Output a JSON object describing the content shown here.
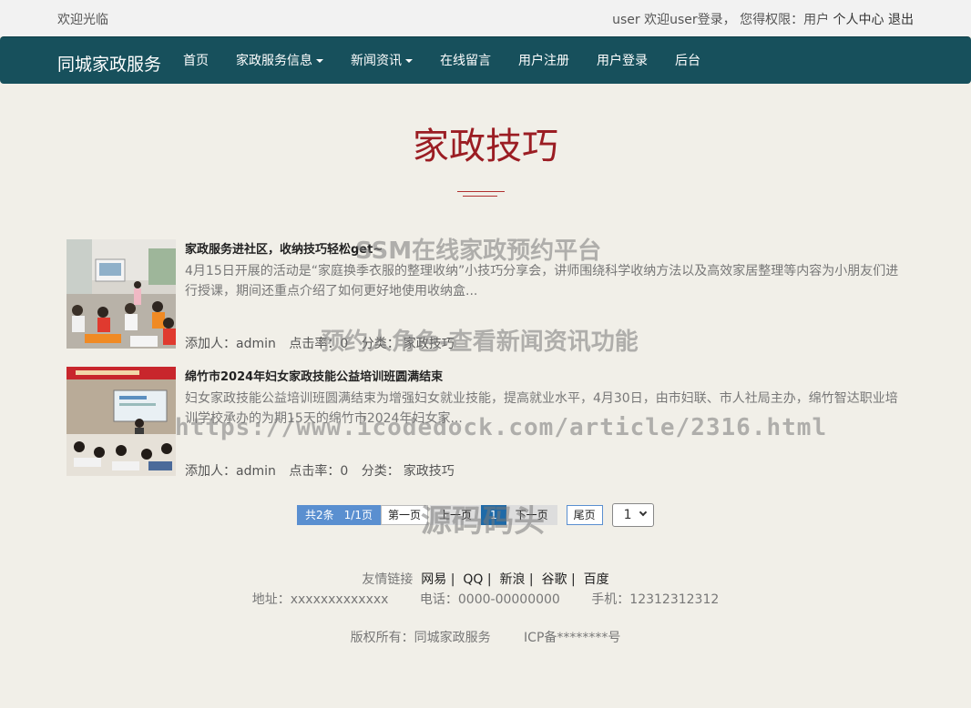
{
  "topbar": {
    "welcome": "欢迎光临",
    "user_text": "user 欢迎user登录， 您得权限：用户",
    "profile_link": "个人中心",
    "logout_link": "退出"
  },
  "nav": {
    "brand": "同城家政服务",
    "items": [
      {
        "label": "首页",
        "dropdown": false
      },
      {
        "label": "家政服务信息",
        "dropdown": true
      },
      {
        "label": "新闻资讯",
        "dropdown": true
      },
      {
        "label": "在线留言",
        "dropdown": false
      },
      {
        "label": "用户注册",
        "dropdown": false
      },
      {
        "label": "用户登录",
        "dropdown": false
      },
      {
        "label": "后台",
        "dropdown": false
      }
    ]
  },
  "page_title": "家政技巧",
  "articles": [
    {
      "title": "家政服务进社区，收纳技巧轻松get~",
      "desc": "4月15日开展的活动是“家庭换季衣服的整理收纳”小技巧分享会，讲师围绕科学收纳方法以及高效家居整理等内容为小朋友们进行授课，期间还重点介绍了如何更好地使用收纳盒...",
      "author_label": "添加人：admin",
      "clicks_label": "点击率：0",
      "category_label": "分类：",
      "category": "家政技巧"
    },
    {
      "title": "绵竹市2024年妇女家政技能公益培训班圆满结束",
      "desc": "妇女家政技能公益培训班圆满结束为增强妇女就业技能，提高就业水平，4月30日，由市妇联、市人社局主办，绵竹智达职业培训学校承办的为期15天的绵竹市2024年妇女家...",
      "author_label": "添加人：admin",
      "clicks_label": "点击率：0",
      "category_label": "分类：",
      "category": "家政技巧"
    }
  ],
  "pager": {
    "total": "共2条",
    "pages": "1/1页",
    "first": "第一页",
    "prev": "上一页",
    "current": "1",
    "next": "下一页",
    "last": "尾页",
    "select_value": "1"
  },
  "footer": {
    "links_label": "友情链接",
    "links": [
      "网易 |",
      "QQ |",
      "新浪 |",
      "谷歌 |",
      "百度"
    ],
    "address": "地址：xxxxxxxxxxxxx",
    "phone": "电话：0000-00000000",
    "mobile": "手机：12312312312",
    "copyright": "版权所有：同城家政服务",
    "icp": "ICP备********号"
  },
  "watermarks": {
    "w1": "SSM在线家政预约平台",
    "w2": "预约人角色-查看新闻资讯功能",
    "w3": "https://www.icodedock.com/article/2316.html",
    "w4": "源码码头"
  },
  "colors": {
    "navbar": "#17505c",
    "title": "#9b1d23",
    "background": "#f1efe8"
  }
}
